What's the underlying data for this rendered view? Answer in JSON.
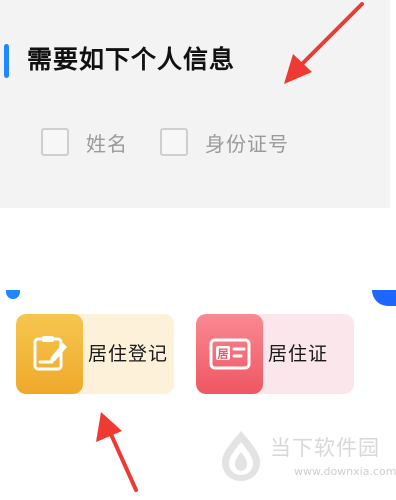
{
  "personal_info": {
    "title": "需要如下个人信息",
    "options": [
      {
        "label": "姓名",
        "checked": false
      },
      {
        "label": "身份证号",
        "checked": false
      }
    ]
  },
  "services": [
    {
      "label": "居住登记",
      "icon": "pencil-document-icon",
      "color": "#f3b63a"
    },
    {
      "label": "居住证",
      "icon": "residence-card-icon",
      "color": "#f36874",
      "icon_text": "居"
    }
  ],
  "watermark": {
    "name": "当下软件园",
    "url": "www.downxia.com"
  },
  "colors": {
    "accent": "#1e88ff",
    "annotation": "#ee3a32"
  }
}
